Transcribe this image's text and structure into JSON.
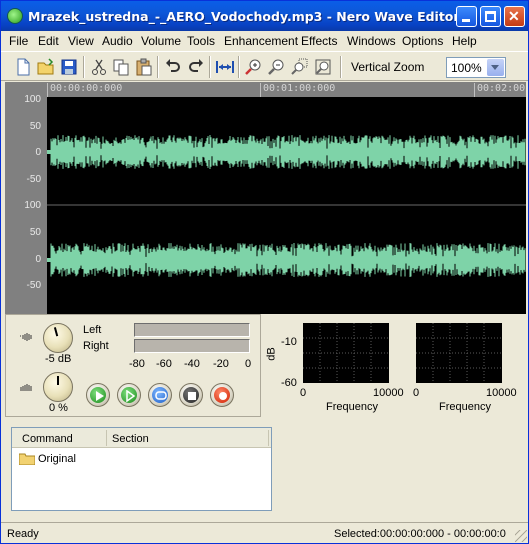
{
  "window": {
    "title": "Mrazek_ustredna_-_AERO_Vodochody.mp3 - Nero Wave Editor",
    "minimize_icon": "minimize-icon",
    "maximize_icon": "maximize-icon",
    "close_icon": "close-icon"
  },
  "menu": [
    "File",
    "Edit",
    "View",
    "Audio",
    "Volume",
    "Tools",
    "Enhancement",
    "Effects",
    "Windows",
    "Options",
    "Help"
  ],
  "toolbar": {
    "icons": [
      "new-file-icon",
      "open-file-icon",
      "save-icon",
      "cut-icon",
      "copy-icon",
      "paste-icon",
      "undo-icon",
      "redo-icon",
      "fit-width-icon",
      "zoom-in-icon",
      "zoom-out-icon",
      "zoom-selection-icon",
      "zoom-full-icon"
    ],
    "vertical_zoom_label": "Vertical Zoom",
    "zoom_value": "100%"
  },
  "waveform": {
    "timeline": [
      "00:00:00:000",
      "00:01:00:000",
      "00:02:00"
    ],
    "y_labels_top": [
      "100",
      "50",
      "0",
      "-50"
    ],
    "y_labels_bottom": [
      "100",
      "50",
      "0",
      "-50"
    ],
    "wave_color": "#7ed3a8",
    "background": "#000000"
  },
  "transport": {
    "volume_value": "-5 dB",
    "pan_value": "0 %",
    "left_label": "Left",
    "right_label": "Right",
    "meter_scale": [
      "-80",
      "-60",
      "-40",
      "-20",
      "0"
    ],
    "buttons": [
      "play-icon",
      "play-selection-icon",
      "loop-icon",
      "stop-icon",
      "record-icon"
    ]
  },
  "spectrum": {
    "ylabel": "dB",
    "y_ticks": [
      "-10",
      "-60"
    ],
    "x_ticks": [
      "0",
      "10000"
    ],
    "xlabel": "Frequency"
  },
  "commands": {
    "col_command": "Command",
    "col_section": "Section",
    "rows": [
      "Original"
    ]
  },
  "status": {
    "left": "Ready",
    "right": "Selected:00:00:00:000 - 00:00:00:0"
  }
}
